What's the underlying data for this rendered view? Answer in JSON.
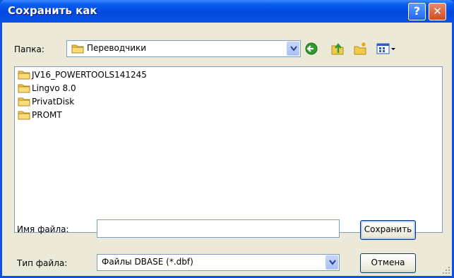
{
  "window": {
    "title": "Сохранить как",
    "help_symbol": "?",
    "close_symbol": "✕"
  },
  "location": {
    "label": "Папка:",
    "value": "Переводчики",
    "toolbar_icons": [
      "back-icon",
      "up-folder-icon",
      "new-folder-icon",
      "view-menu-icon"
    ]
  },
  "files": [
    {
      "name": "JV16_POWERTOOLS141245",
      "icon": "folder-icon"
    },
    {
      "name": "Lingvo 8.0",
      "icon": "folder-icon"
    },
    {
      "name": "PrivatDisk",
      "icon": "folder-icon"
    },
    {
      "name": "PROMT",
      "icon": "folder-icon"
    }
  ],
  "filename": {
    "label": "Имя файла:",
    "value": ""
  },
  "filetype": {
    "label": "Тип файла:",
    "value": "Файлы DBASE (*.dbf)"
  },
  "buttons": {
    "save": "Сохранить",
    "cancel": "Отмена"
  },
  "colors": {
    "titlebar": "#0a53e4",
    "dialog_bg": "#ece9d8",
    "folder": "#f2c94c"
  }
}
